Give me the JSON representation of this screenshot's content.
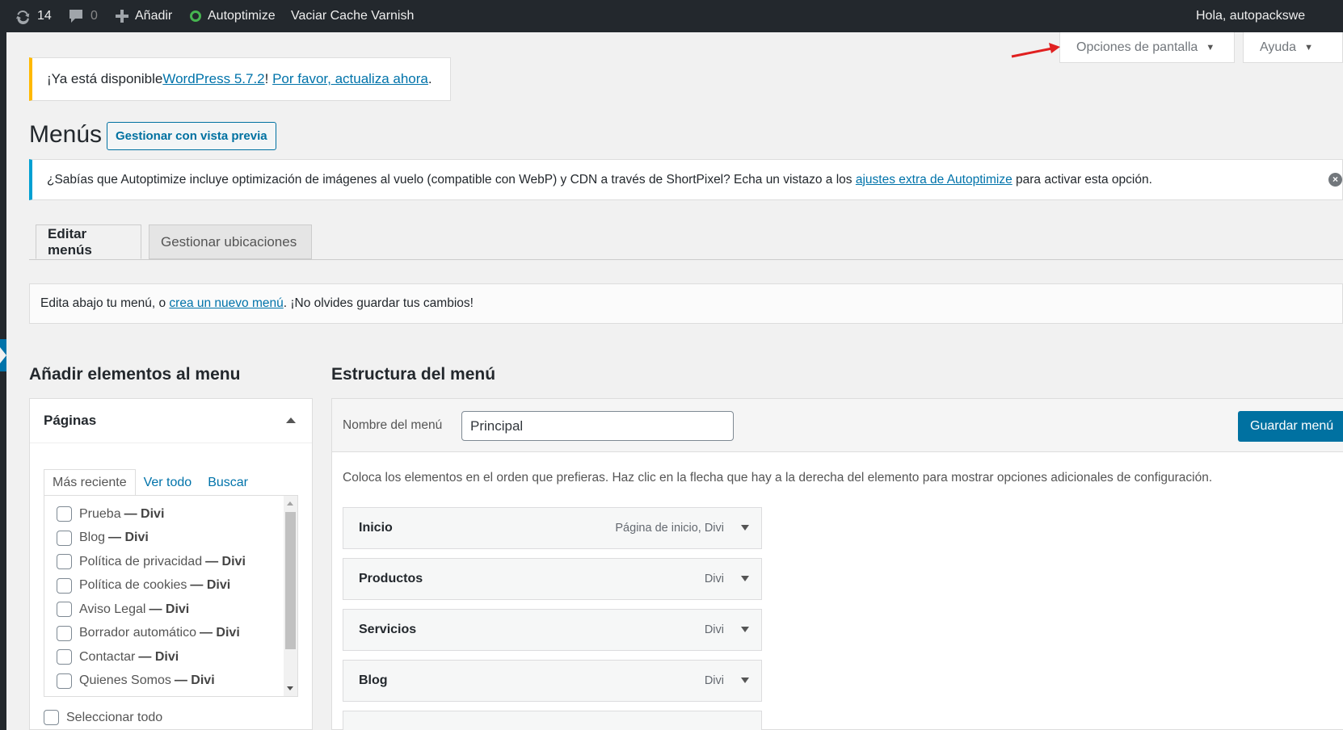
{
  "adminbar": {
    "updates_count": "14",
    "comments_count": "0",
    "add_label": "Añadir",
    "autoptimize_label": "Autoptimize",
    "varnish_label": "Vaciar Cache Varnish",
    "greeting": "Hola, autopackswe"
  },
  "screen_meta": {
    "options_label": "Opciones de pantalla",
    "help_label": "Ayuda"
  },
  "update_notice": {
    "prefix": "¡Ya está disponible ",
    "version_link": "WordPress 5.7.2",
    "middle": "! ",
    "update_link": "Por favor, actualiza ahora",
    "suffix": "."
  },
  "page": {
    "title": "Menús",
    "preview_button": "Gestionar con vista previa"
  },
  "autoptimize_notice": {
    "text": "¿Sabías que Autoptimize incluye optimización de imágenes al vuelo (compatible con WebP) y CDN a través de ShortPixel? Echa un vistazo a los ",
    "link": "ajustes extra de Autoptimize",
    "suffix": " para activar esta opción."
  },
  "tabs": {
    "edit": "Editar menús",
    "manage": "Gestionar ubicaciones"
  },
  "manage_notice": {
    "prefix": "Edita abajo tu menú, o ",
    "link": "crea un nuevo menú",
    "suffix": ". ¡No olvides guardar tus cambios!"
  },
  "add_items": {
    "heading": "Añadir elementos al menu",
    "box_title": "Páginas",
    "subtabs": [
      "Más reciente",
      "Ver todo",
      "Buscar"
    ],
    "pages": [
      {
        "name": "Prueba",
        "suffix": "— Divi"
      },
      {
        "name": "Blog",
        "suffix": "— Divi"
      },
      {
        "name": "Política de privacidad",
        "suffix": "— Divi"
      },
      {
        "name": "Política de cookies",
        "suffix": "— Divi"
      },
      {
        "name": "Aviso Legal",
        "suffix": "— Divi"
      },
      {
        "name": "Borrador automático",
        "suffix": "— Divi"
      },
      {
        "name": "Contactar",
        "suffix": "— Divi"
      },
      {
        "name": "Quienes Somos",
        "suffix": "— Divi"
      }
    ],
    "select_all": "Seleccionar todo"
  },
  "structure": {
    "heading": "Estructura del menú",
    "name_label": "Nombre del menú",
    "name_value": "Principal",
    "save_button": "Guardar menú",
    "instructions": "Coloca los elementos en el orden que prefieras. Haz clic en la flecha que hay a la derecha del elemento para mostrar opciones adicionales de configuración.",
    "items": [
      {
        "title": "Inicio",
        "meta": "Página de inicio, Divi"
      },
      {
        "title": "Productos",
        "meta": "Divi"
      },
      {
        "title": "Servicios",
        "meta": "Divi"
      },
      {
        "title": "Blog",
        "meta": "Divi"
      }
    ]
  },
  "colors": {
    "adminbar": "#23282d",
    "link": "#0073aa",
    "primary_button": "#0071a1",
    "update_border": "#ffb900",
    "info_border": "#00a0d2",
    "annotation_arrow": "#e02020"
  }
}
